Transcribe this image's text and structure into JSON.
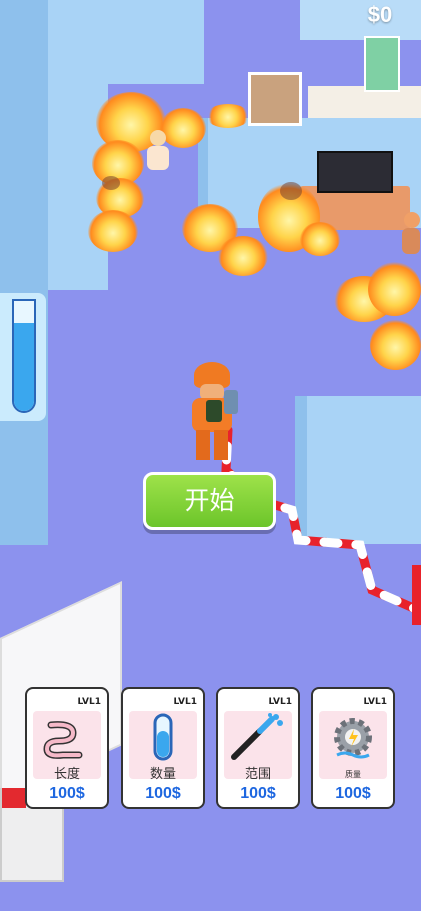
{
  "hud": {
    "money": "$0",
    "water_level": 0.8
  },
  "start_button": {
    "label": "开始"
  },
  "upgrades": [
    {
      "level": "LVL1",
      "name": "长度",
      "price": "100$",
      "icon": "hose-length-icon"
    },
    {
      "level": "LVL1",
      "name": "数量",
      "price": "100$",
      "icon": "water-tube-icon"
    },
    {
      "level": "LVL1",
      "name": "范围",
      "price": "100$",
      "icon": "nozzle-spray-icon"
    },
    {
      "level": "LVL1",
      "name": "质量",
      "price": "100$",
      "icon": "gear-quality-icon"
    }
  ],
  "colors": {
    "floor": "#8c92ee",
    "wall": "#a9d3f6",
    "button_green": "#7fd236",
    "price_blue": "#1e67e0",
    "card_icon_bg": "#fbe3ea"
  }
}
